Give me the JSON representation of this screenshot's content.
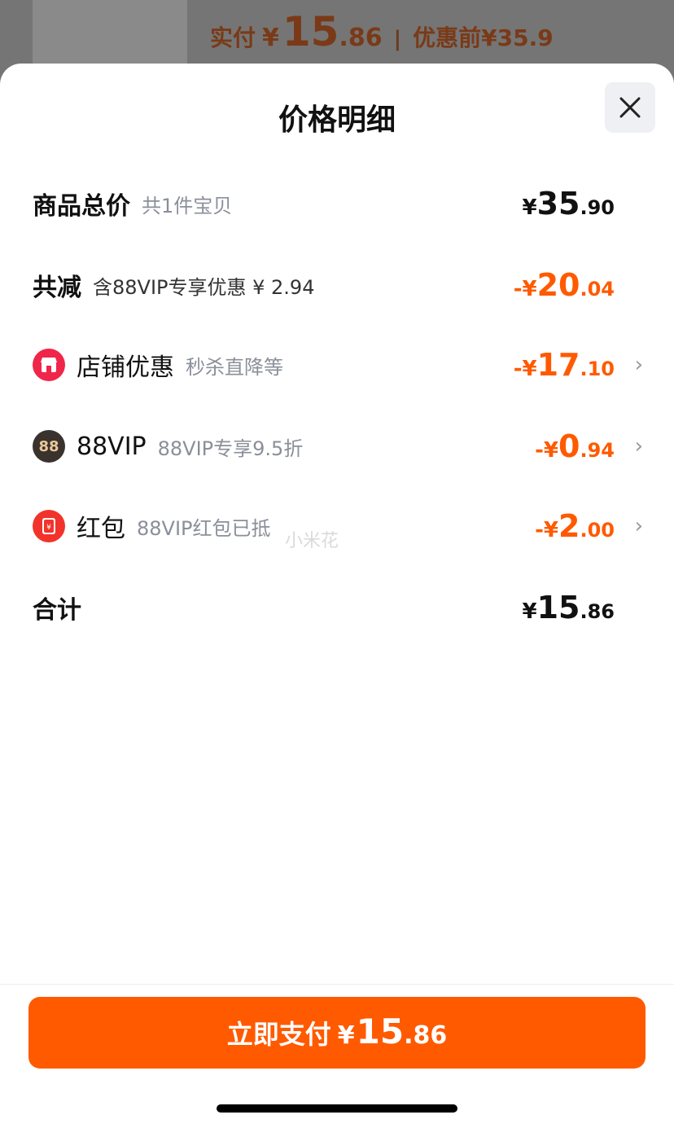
{
  "background": {
    "paid_label": "实付",
    "paid_currency": "¥",
    "paid_int": "15",
    "paid_dec": ".86",
    "separator": "|",
    "original_label": "优惠前",
    "original_price": "¥35.9"
  },
  "sheet": {
    "title": "价格明细",
    "close_icon": "close-icon"
  },
  "rows": {
    "total": {
      "label": "商品总价",
      "sub": "共1件宝贝",
      "currency": "¥",
      "int": "35",
      "dec": ".90"
    },
    "reduced": {
      "label": "共减",
      "sub": "含88VIP专享优惠 ¥ 2.94",
      "currency": "-¥",
      "int": "20",
      "dec": ".04"
    },
    "shop": {
      "icon": "store-icon",
      "label": "店铺优惠",
      "sub": "秒杀直降等",
      "currency": "-¥",
      "int": "17",
      "dec": ".10"
    },
    "vip": {
      "icon": "88vip-icon",
      "icon_text": "88",
      "label": "88VIP",
      "sub": "88VIP专享9.5折",
      "currency": "-¥",
      "int": "0",
      "dec": ".94"
    },
    "redpacket": {
      "icon": "red-packet-icon",
      "label": "红包",
      "sub": "88VIP红包已抵",
      "currency": "-¥",
      "int": "2",
      "dec": ".00"
    },
    "sum": {
      "label": "合计",
      "currency": "¥",
      "int": "15",
      "dec": ".86"
    }
  },
  "pay_button": {
    "label": "立即支付",
    "currency": "¥",
    "int": "15",
    "dec": ".86"
  },
  "watermark": "小米花",
  "colors": {
    "accent": "#ff5a00",
    "store_red": "#f0254a",
    "vip_dark": "#3a322c",
    "vip_gold": "#e8c79a",
    "packet_red": "#f2332b"
  }
}
